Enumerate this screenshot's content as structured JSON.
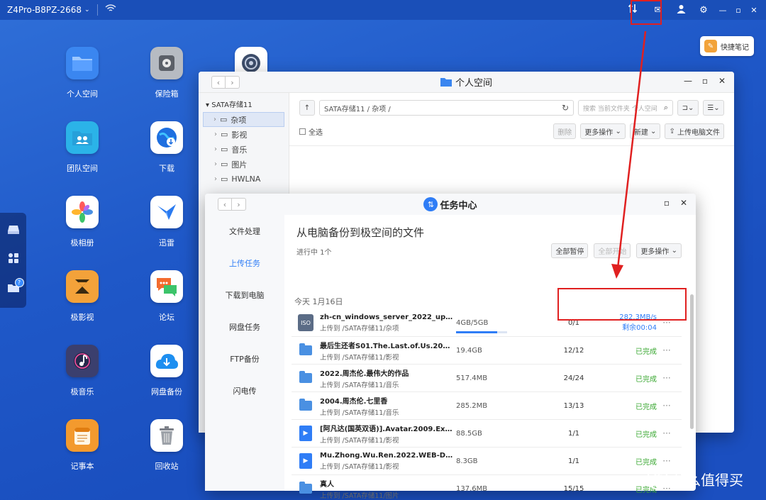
{
  "topbar": {
    "device_name": "Z4Pro-B8PZ-2668",
    "icons": [
      "transfer-icon",
      "message-icon",
      "user-icon",
      "settings-icon"
    ]
  },
  "desktop": {
    "apps": [
      {
        "label": "个人空间",
        "icon": "folder-icon",
        "color": "#3a86f0"
      },
      {
        "label": "保险箱",
        "icon": "safe-icon",
        "color": "#9aa0a8"
      },
      {
        "label": "团队空间",
        "icon": "team-folder-icon",
        "color": "#2bb3e8"
      },
      {
        "label": "下载",
        "icon": "globe-download-icon",
        "color": "#1e6fe0"
      },
      {
        "label": "极相册",
        "icon": "photos-icon",
        "color": "#ffffff"
      },
      {
        "label": "迅雷",
        "icon": "thunder-icon",
        "color": "#ffffff"
      },
      {
        "label": "极影视",
        "icon": "video-icon",
        "color": "#f3a23a"
      },
      {
        "label": "论坛",
        "icon": "forum-icon",
        "color": "#ffffff"
      },
      {
        "label": "极音乐",
        "icon": "music-icon",
        "color": "#3b3f6e"
      },
      {
        "label": "网盘备份",
        "icon": "cloud-backup-icon",
        "color": "#ffffff"
      },
      {
        "label": "记事本",
        "icon": "notepad-icon",
        "color": "#f39a2e"
      },
      {
        "label": "回收站",
        "icon": "trash-icon",
        "color": "#ffffff"
      }
    ]
  },
  "quick_note": {
    "label": "快捷笔记"
  },
  "personal_space": {
    "title": "个人空间",
    "tree_root": "SATA存储11",
    "tree_items": [
      "杂项",
      "影视",
      "音乐",
      "图片",
      "HWLNA"
    ],
    "path": "SATA存储11 / 杂项 /",
    "search_placeholder": "搜索 当前文件夹 个人空间",
    "select_all": "全选",
    "buttons": {
      "delete": "删除",
      "more": "更多操作",
      "new": "新建",
      "upload": "上传电脑文件"
    }
  },
  "task_center": {
    "title": "任务中心",
    "nav": [
      "文件处理",
      "上传任务",
      "下载到电脑",
      "网盘任务",
      "FTP备份",
      "闪电传"
    ],
    "active_nav": 1,
    "heading": "从电脑备份到极空间的文件",
    "subheading": "进行中 1个",
    "buttons": {
      "pause_all": "全部暂停",
      "start_all": "全部开始",
      "more": "更多操作"
    },
    "date_group": "今天 1月16日",
    "tasks": [
      {
        "name": "zh-cn_windows_server_2022_updated...",
        "path": "上传到 /SATA存储11/杂项",
        "size": "4GB/5GB",
        "progress": 0.8,
        "count": "0/1",
        "speed": "282.3MB/s",
        "remain": "剩余00:04",
        "icon": "iso-icon"
      },
      {
        "name": "最后生还者S01.The.Last.of.Us.2023.108...",
        "path": "上传到 /SATA存储11/影视",
        "size": "19.4GB",
        "count": "12/12",
        "status": "已完成",
        "icon": "folder-icon"
      },
      {
        "name": "2022.周杰伦.最伟大的作品",
        "path": "上传到 /SATA存储11/音乐",
        "size": "517.4MB",
        "count": "24/24",
        "status": "已完成",
        "icon": "folder-icon"
      },
      {
        "name": "2004.周杰伦.七里香",
        "path": "上传到 /SATA存储11/音乐",
        "size": "285.2MB",
        "count": "13/13",
        "status": "已完成",
        "icon": "folder-icon"
      },
      {
        "name": "[阿凡达(国英双语)].Avatar.2009.Extend...",
        "path": "上传到 /SATA存储11/影视",
        "size": "88.5GB",
        "count": "1/1",
        "status": "已完成",
        "icon": "video-icon"
      },
      {
        "name": "Mu.Zhong.Wu.Ren.2022.WEB-DL.4k...",
        "path": "上传到 /SATA存储11/影视",
        "size": "8.3GB",
        "count": "1/1",
        "status": "已完成",
        "icon": "video-icon"
      },
      {
        "name": "真人",
        "path": "上传到 /SATA存储11/图片",
        "size": "137.6MB",
        "count": "15/15",
        "status": "已完成",
        "icon": "folder-icon"
      }
    ]
  },
  "watermark": {
    "text": "什么值得买",
    "logo": "值"
  }
}
